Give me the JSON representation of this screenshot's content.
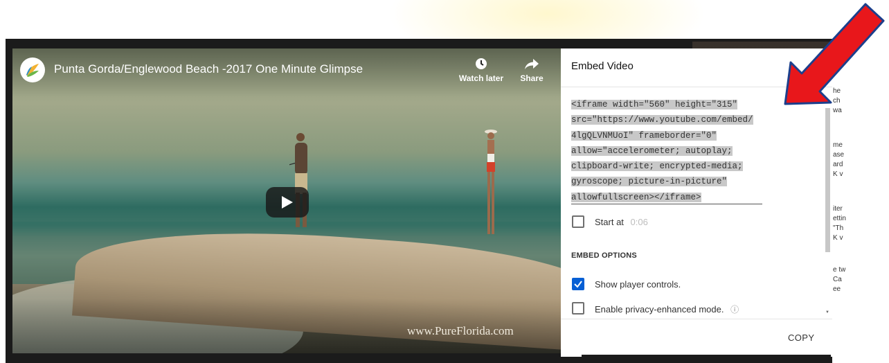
{
  "video": {
    "title": "Punta Gorda/Englewood Beach -2017 One Minute Glimpse",
    "watch_later_label": "Watch later",
    "share_label": "Share",
    "watermark": "www.PureFlorida.com",
    "icons": {
      "clock": "clock-icon",
      "share": "share-arrow-icon",
      "play": "play-icon",
      "logo": "channel-logo-icon"
    }
  },
  "embed_panel": {
    "title": "Embed Video",
    "code_lines": [
      "<iframe width=\"560\" height=\"315\"",
      "src=\"https://www.youtube.com/embed/",
      "4lgQLVNMUoI\" frameborder=\"0\"",
      "allow=\"accelerometer; autoplay;",
      "clipboard-write; encrypted-media;",
      "gyroscope; picture-in-picture\"",
      "allowfullscreen></iframe>"
    ],
    "start_at_label": "Start at",
    "start_at_value": "0:06",
    "start_at_checked": false,
    "embed_options_heading": "EMBED OPTIONS",
    "show_controls_label": "Show player controls.",
    "show_controls_checked": true,
    "privacy_label": "Enable privacy-enhanced mode.",
    "privacy_checked": false,
    "copy_label": "COPY"
  },
  "colors": {
    "accent_blue": "#065fd4",
    "annotation_arrow": "#e8171b",
    "arrow_outline": "#1c3f8c"
  }
}
